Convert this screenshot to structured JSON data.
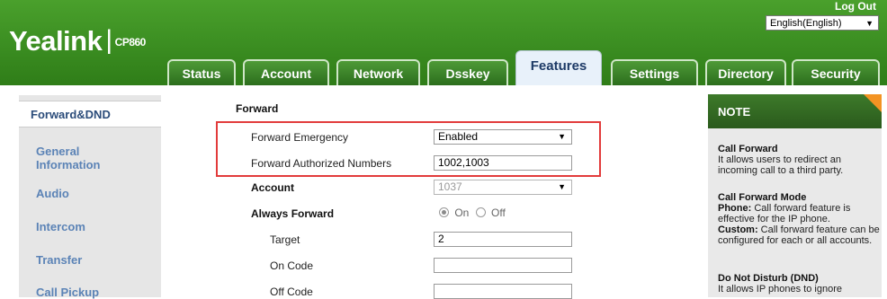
{
  "header": {
    "logo_brand": "Yealink",
    "logo_sep": "|",
    "logo_model": "CP860",
    "logout": "Log Out",
    "language": "English(English)",
    "tabs": [
      "Status",
      "Account",
      "Network",
      "Dsskey",
      "Features",
      "Settings",
      "Directory",
      "Security"
    ],
    "active_tab": "Features"
  },
  "sidebar": {
    "active": "Forward&DND",
    "items": [
      "General Information",
      "Audio",
      "Intercom",
      "Transfer",
      "Call Pickup"
    ]
  },
  "form": {
    "section": "Forward",
    "forward_emergency_label": "Forward Emergency",
    "forward_emergency_value": "Enabled",
    "forward_authorized_label": "Forward Authorized Numbers",
    "forward_authorized_value": "1002,1003",
    "account_label": "Account",
    "account_value": "1037",
    "always_forward_label": "Always Forward",
    "on_label": "On",
    "off_label": "Off",
    "target_label": "Target",
    "target_value": "2",
    "on_code_label": "On Code",
    "on_code_value": "",
    "off_code_label": "Off Code",
    "off_code_value": ""
  },
  "note": {
    "title": "NOTE",
    "call_forward_title": "Call Forward",
    "call_forward_text": "It allows users to redirect an incoming call to a third party.",
    "mode_title": "Call Forward Mode",
    "phone_label": "Phone:",
    "phone_text": "Call forward feature is effective for the IP phone.",
    "custom_label": "Custom:",
    "custom_text": "Call forward feature can be configured for each or all accounts.",
    "dnd_title": "Do Not Disturb (DND)",
    "dnd_text": "It allows IP phones to ignore"
  },
  "colors": {
    "header_green": "#3c8f22",
    "highlight_red": "#e23b3b",
    "note_corner_orange": "#f39323",
    "sidebar_link_blue": "#5b83b6"
  }
}
